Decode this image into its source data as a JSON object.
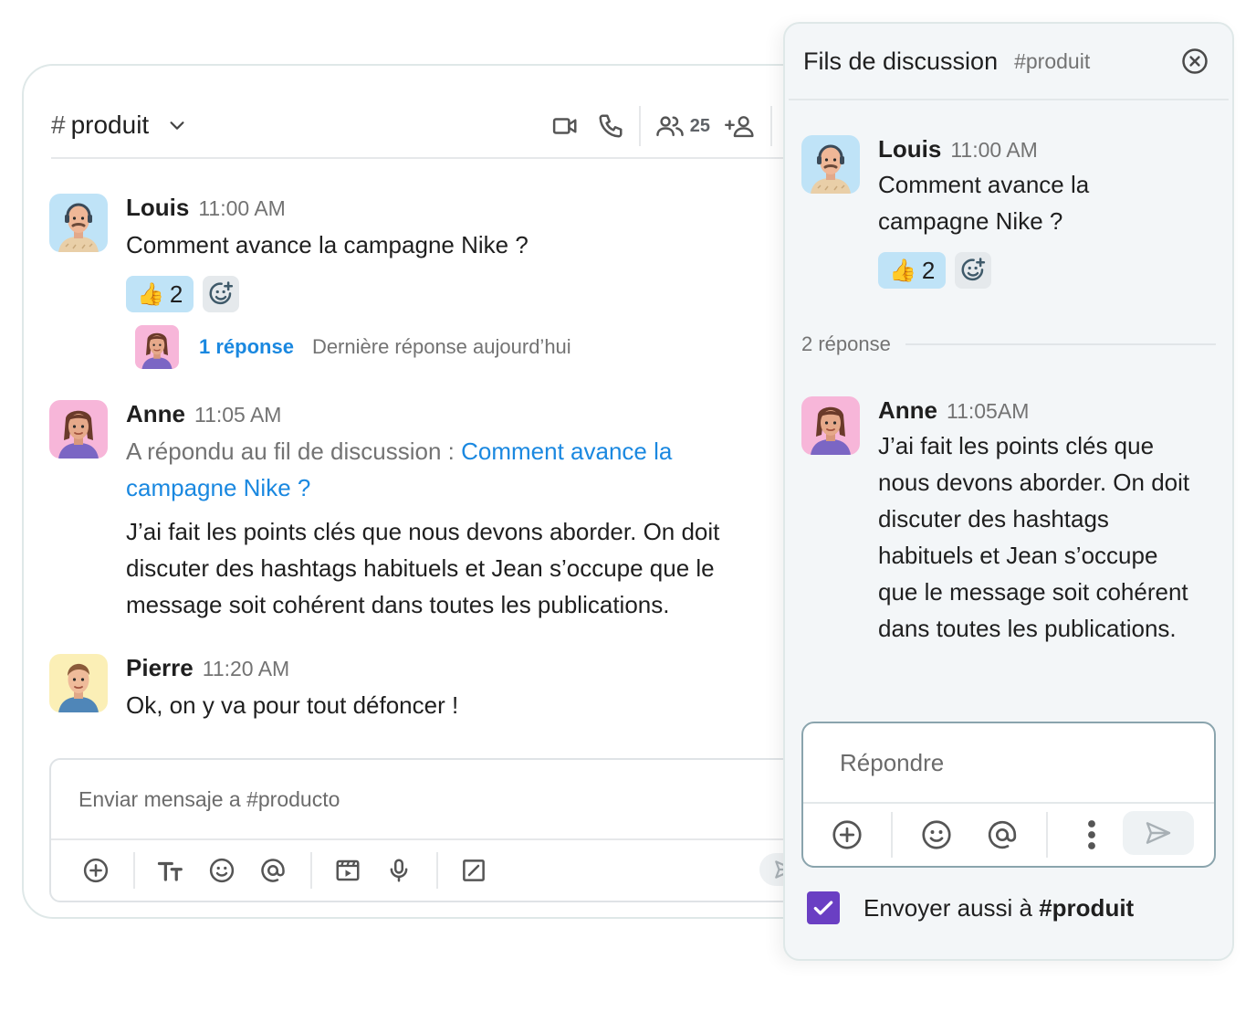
{
  "channel": {
    "hash": "#",
    "name": "produit",
    "member_count": "25"
  },
  "messages": [
    {
      "author": "Louis",
      "time": "11:00 AM",
      "text": "Comment avance la campagne Nike ?",
      "reaction_emoji": "👍",
      "reaction_count": "2",
      "reply_count_label": "1 réponse",
      "last_reply_label": "Dernière réponse aujourd’hui"
    },
    {
      "author": "Anne",
      "time": "11:05 AM",
      "reply_prefix": "A répondu au fil de discussion : ",
      "reply_link": "Comment avance la campagne Nike ?",
      "text": "J’ai fait les points clés que nous devons aborder. On doit discuter des hashtags habituels et Jean s’occupe que le message soit cohérent dans toutes les publications."
    },
    {
      "author": "Pierre",
      "time": "11:20 AM",
      "text": "Ok, on y va pour tout défoncer !"
    }
  ],
  "composer": {
    "placeholder": "Enviar mensaje a #producto"
  },
  "thread": {
    "title": "Fils de discussion",
    "channel": "#produit",
    "root": {
      "author": "Louis",
      "time": "11:00 AM",
      "text": "Comment avance la campagne Nike ?",
      "reaction_emoji": "👍",
      "reaction_count": "2"
    },
    "replies_label": "2 réponse",
    "reply": {
      "author": "Anne",
      "time": "11:05AM",
      "text": "J’ai fait les points clés que nous devons aborder. On doit discuter des hashtags habituels et Jean s’occupe que le message soit cohérent dans toutes les publications."
    },
    "reply_placeholder": "Répondre",
    "also_send_prefix": "Envoyer aussi à ",
    "also_send_channel": "#produit",
    "also_send_checked": true
  },
  "colors": {
    "link": "#1a88e0",
    "reaction_bg": "#bfe3f7",
    "checkbox": "#6a3fc3",
    "avatar_louis_bg": "#bfe3f7",
    "avatar_anne_bg": "#f7b6d9",
    "avatar_pierre_bg": "#fbefb6"
  },
  "icons": {
    "header": [
      "video-icon",
      "phone-icon",
      "members-icon",
      "add-member-icon",
      "pin-icon"
    ],
    "composer": [
      "add-icon",
      "text-format-icon",
      "emoji-icon",
      "mention-icon",
      "media-icon",
      "microphone-icon",
      "edit-icon",
      "send-icon"
    ],
    "thread": [
      "close-icon",
      "add-icon",
      "emoji-icon",
      "mention-icon",
      "more-icon",
      "send-icon",
      "checkbox-check-icon"
    ]
  }
}
